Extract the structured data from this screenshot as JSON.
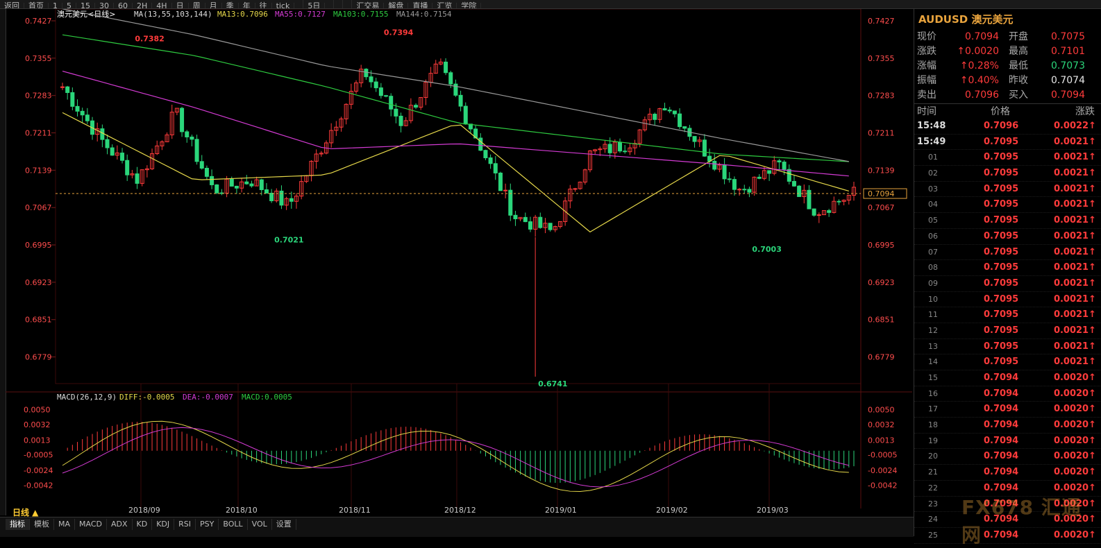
{
  "toolbar": {
    "items": [
      "返回",
      "首页",
      "1",
      "5",
      "15",
      "30",
      "60",
      "2H",
      "4H",
      "日",
      "周",
      "月",
      "季",
      "年",
      "往",
      "tick",
      "",
      "5日",
      "",
      "",
      "",
      "汇交易",
      "解盘",
      "直播",
      "汇览",
      "学院"
    ]
  },
  "chart_header": {
    "symbol_label": "澳元美元",
    "period_label": "<日线>",
    "ma_label": "MA(13,55,103,144)",
    "ma13": "MA13:0.7096",
    "ma55": "MA55:0.7127",
    "ma103": "MA103:0.7155",
    "ma144": "MA144:0.7154"
  },
  "macd_header": {
    "label": "MACD(26,12,9)",
    "diff": "DIFF:-0.0005",
    "dea": "DEA:-0.0007",
    "macd": "MACD:0.0005"
  },
  "price_axis": [
    "0.7427",
    "0.7355",
    "0.7283",
    "0.7211",
    "0.7139",
    "0.7067",
    "0.6995",
    "0.6923",
    "0.6851",
    "0.6779"
  ],
  "macd_axis": [
    "0.0050",
    "0.0032",
    "0.0013",
    "-0.0005",
    "-0.0024",
    "-0.0042"
  ],
  "date_axis": [
    "2018/09",
    "2018/10",
    "2018/11",
    "2018/12",
    "2019/01",
    "2019/02",
    "2019/03"
  ],
  "annotations": {
    "high1": "0.7382",
    "high2": "0.7394",
    "low1": "0.7021",
    "low2": "0.6741",
    "low3": "0.7003",
    "current_price": "0.7094"
  },
  "colors": {
    "up": "#ff3b3b",
    "down": "#2bd67b",
    "ma13": "#e6d84a",
    "ma55": "#d43bd4",
    "ma103": "#2ecc40",
    "ma144": "#999999",
    "grid": "#4a1010"
  },
  "chart_data": {
    "type": "line",
    "title": "澳元美元<日线>",
    "ylim": [
      0.6741,
      0.7427
    ],
    "x": [
      "2018/09",
      "2018/10",
      "2018/11",
      "2018/12",
      "2019/01",
      "2019/02",
      "2019/03"
    ],
    "series": [
      {
        "name": "MA13",
        "values": [
          0.725,
          0.712,
          0.713,
          0.723,
          0.702,
          0.717,
          0.7096
        ]
      },
      {
        "name": "MA55",
        "values": [
          0.733,
          0.726,
          0.718,
          0.719,
          0.717,
          0.715,
          0.7127
        ]
      },
      {
        "name": "MA103",
        "values": [
          0.74,
          0.736,
          0.73,
          0.723,
          0.72,
          0.717,
          0.7155
        ]
      },
      {
        "name": "MA144",
        "values": [
          0.745,
          0.74,
          0.734,
          0.73,
          0.725,
          0.72,
          0.7154
        ]
      }
    ],
    "current": 0.7094,
    "extremes": {
      "high": [
        0.7382,
        0.7394
      ],
      "low": [
        0.7021,
        0.6741,
        0.7003
      ]
    }
  },
  "quote_panel": {
    "title_code": "AUDUSD",
    "title_name": "澳元美元",
    "rows": [
      {
        "l": "现价",
        "v": "0.7094",
        "vc": "red",
        "l2": "开盘",
        "v2": "0.7075",
        "v2c": "red"
      },
      {
        "l": "涨跌",
        "v": "↑0.0020",
        "vc": "red",
        "l2": "最高",
        "v2": "0.7101",
        "v2c": "red"
      },
      {
        "l": "涨幅",
        "v": "↑0.28%",
        "vc": "red",
        "l2": "最低",
        "v2": "0.7073",
        "v2c": "green"
      },
      {
        "l": "振幅",
        "v": "↑0.40%",
        "vc": "red",
        "l2": "昨收",
        "v2": "0.7074",
        "v2c": "white"
      },
      {
        "l": "卖出",
        "v": "0.7096",
        "vc": "red",
        "l2": "买入",
        "v2": "0.7094",
        "v2c": "red"
      }
    ],
    "tick_headers": {
      "time": "时间",
      "price": "价格",
      "change": "涨跌"
    },
    "ticks": [
      {
        "t": "15:48",
        "p": "0.7096",
        "c": "0.0022↑",
        "sm": false
      },
      {
        "t": "15:49",
        "p": "0.7095",
        "c": "0.0021↑",
        "sm": false
      },
      {
        "t": "01",
        "p": "0.7095",
        "c": "0.0021↑",
        "sm": true
      },
      {
        "t": "02",
        "p": "0.7095",
        "c": "0.0021↑",
        "sm": true
      },
      {
        "t": "03",
        "p": "0.7095",
        "c": "0.0021↑",
        "sm": true
      },
      {
        "t": "04",
        "p": "0.7095",
        "c": "0.0021↑",
        "sm": true
      },
      {
        "t": "05",
        "p": "0.7095",
        "c": "0.0021↑",
        "sm": true
      },
      {
        "t": "06",
        "p": "0.7095",
        "c": "0.0021↑",
        "sm": true
      },
      {
        "t": "07",
        "p": "0.7095",
        "c": "0.0021↑",
        "sm": true
      },
      {
        "t": "08",
        "p": "0.7095",
        "c": "0.0021↑",
        "sm": true
      },
      {
        "t": "09",
        "p": "0.7095",
        "c": "0.0021↑",
        "sm": true
      },
      {
        "t": "10",
        "p": "0.7095",
        "c": "0.0021↑",
        "sm": true
      },
      {
        "t": "11",
        "p": "0.7095",
        "c": "0.0021↑",
        "sm": true
      },
      {
        "t": "12",
        "p": "0.7095",
        "c": "0.0021↑",
        "sm": true
      },
      {
        "t": "13",
        "p": "0.7095",
        "c": "0.0021↑",
        "sm": true
      },
      {
        "t": "14",
        "p": "0.7095",
        "c": "0.0021↑",
        "sm": true
      },
      {
        "t": "15",
        "p": "0.7094",
        "c": "0.0020↑",
        "sm": true
      },
      {
        "t": "16",
        "p": "0.7094",
        "c": "0.0020↑",
        "sm": true
      },
      {
        "t": "17",
        "p": "0.7094",
        "c": "0.0020↑",
        "sm": true
      },
      {
        "t": "18",
        "p": "0.7094",
        "c": "0.0020↑",
        "sm": true
      },
      {
        "t": "19",
        "p": "0.7094",
        "c": "0.0020↑",
        "sm": true
      },
      {
        "t": "20",
        "p": "0.7094",
        "c": "0.0020↑",
        "sm": true
      },
      {
        "t": "21",
        "p": "0.7094",
        "c": "0.0020↑",
        "sm": true
      },
      {
        "t": "22",
        "p": "0.7094",
        "c": "0.0020↑",
        "sm": true
      },
      {
        "t": "23",
        "p": "0.7094",
        "c": "0.0020↑",
        "sm": true
      },
      {
        "t": "24",
        "p": "0.7094",
        "c": "0.0020↑",
        "sm": true
      },
      {
        "t": "25",
        "p": "0.7094",
        "c": "0.0020↑",
        "sm": true
      }
    ]
  },
  "bottom_tabs": [
    "指标",
    "模板",
    "MA",
    "MACD",
    "ADX",
    "KD",
    "KDJ",
    "RSI",
    "PSY",
    "BOLL",
    "VOL",
    "设置"
  ],
  "period_badge": "日线 ▲",
  "watermark": "FX678 汇通网"
}
